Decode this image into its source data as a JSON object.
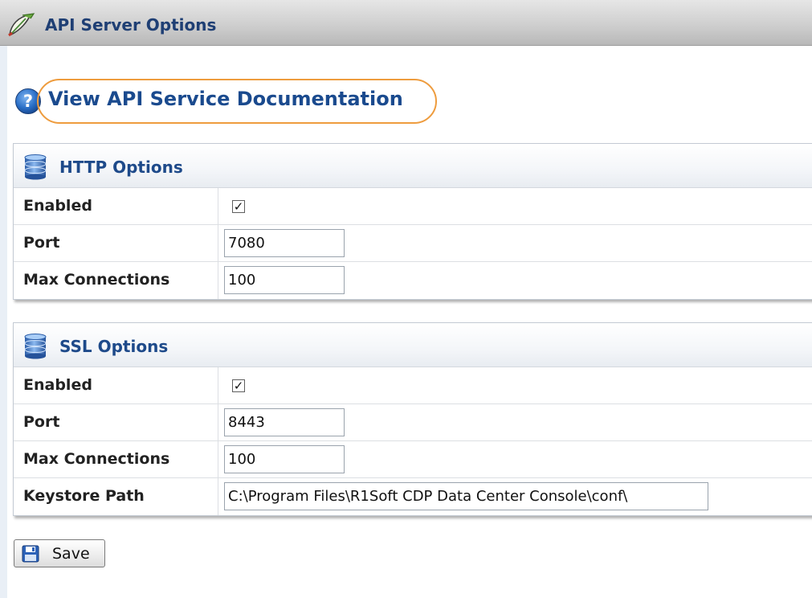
{
  "window": {
    "title": "API Server Options",
    "icon": "pencil-leaf-icon"
  },
  "doc_link": {
    "label": "View API Service Documentation",
    "icon": "help-icon",
    "highlight_color": "#ee9c3e"
  },
  "http_options": {
    "title": "HTTP Options",
    "icon": "database-icon",
    "rows": {
      "enabled": {
        "label": "Enabled",
        "checked": true,
        "check_mark": "✓"
      },
      "port": {
        "label": "Port",
        "value": "7080"
      },
      "max_connections": {
        "label": "Max Connections",
        "value": "100"
      }
    }
  },
  "ssl_options": {
    "title": "SSL Options",
    "icon": "database-icon",
    "rows": {
      "enabled": {
        "label": "Enabled",
        "checked": true,
        "check_mark": "✓"
      },
      "port": {
        "label": "Port",
        "value": "8443"
      },
      "max_connections": {
        "label": "Max Connections",
        "value": "100"
      },
      "keystore_path": {
        "label": "Keystore Path",
        "value": "C:\\Program Files\\R1Soft CDP Data Center Console\\conf\\"
      }
    }
  },
  "save_button": {
    "label": "Save",
    "icon": "floppy-disk-icon"
  },
  "colors": {
    "title_text": "#1f3f74",
    "link_text": "#1a4a8e",
    "panel_title": "#1e4a8a",
    "highlight": "#ee9c3e"
  }
}
